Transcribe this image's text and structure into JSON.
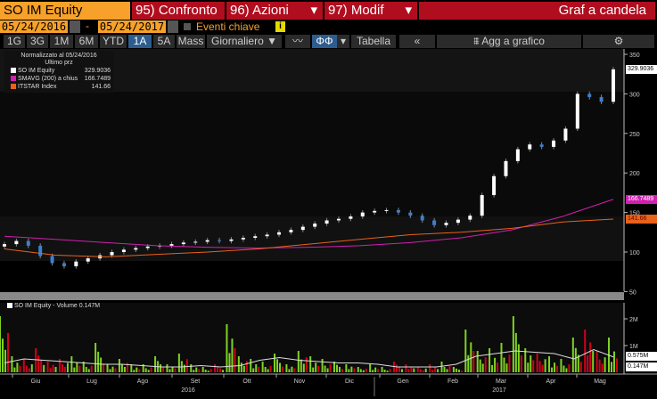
{
  "header": {
    "ticker": "SO IM Equity",
    "menu1": "95) Confronto",
    "menu2": "96) Azioni",
    "menu3": "97) Modif",
    "title": "Graf a candela"
  },
  "dates": {
    "start": "05/24/2016",
    "end": "05/24/2017",
    "separator": "-",
    "events_label": "Eventi chiave",
    "info_icon": "i"
  },
  "toolbar": {
    "periods": [
      "1G",
      "3G",
      "1M",
      "6M",
      "YTD",
      "1A",
      "5A",
      "Mass"
    ],
    "selected": "1A",
    "frequency": "Giornaliero ▼",
    "table": "Tabella",
    "back": "«",
    "add": "Agg a grafico"
  },
  "legend": {
    "title": "Normalizzato al 05/24/2016",
    "subtitle": "Ultimo prz",
    "items": [
      {
        "name": "SO IM Equity",
        "value": "329.9036",
        "color": "#ffffff"
      },
      {
        "name": "SMAVG (200) a chius",
        "value": "166.7489",
        "color": "#d020b0"
      },
      {
        "name": "ITSTAR Index",
        "value": "141.66",
        "color": "#e8621a"
      }
    ]
  },
  "volume_legend": {
    "name": "SO IM Equity - Volume",
    "value": "0.147M"
  },
  "price_labels": {
    "last": "329.9036",
    "sma": "166.7489",
    "index": "141.66"
  },
  "volume_labels": {
    "avg": "0.575M",
    "last": "0.147M"
  },
  "chart_data": {
    "type": "candlestick",
    "y_ticks": [
      "350",
      "300",
      "250",
      "200",
      "150",
      "100",
      "50"
    ],
    "y_tick_values": [
      350,
      300,
      250,
      200,
      150,
      100,
      50
    ],
    "ylim": [
      50,
      350
    ],
    "vol_ticks": [
      "2M",
      "1M"
    ],
    "vol_tick_values": [
      2,
      1
    ],
    "vol_ylim": [
      0,
      2.7
    ],
    "months": [
      "Giu",
      "Lug",
      "Ago",
      "Set",
      "Ott",
      "Nov",
      "Dic",
      "Gen",
      "Feb",
      "Mar",
      "Apr",
      "Mag"
    ],
    "years": [
      "2016",
      "2017"
    ],
    "closes": [
      110,
      114,
      108,
      95,
      86,
      82,
      88,
      92,
      96,
      100,
      103,
      105,
      107,
      108,
      110,
      112,
      113,
      115,
      114,
      116,
      118,
      120,
      122,
      125,
      128,
      132,
      136,
      140,
      142,
      145,
      150,
      152,
      153,
      150,
      146,
      140,
      134,
      137,
      141,
      146,
      172,
      196,
      215,
      230,
      236,
      233,
      241,
      256,
      300,
      296,
      290,
      331
    ],
    "sma": [
      120,
      116,
      112,
      108,
      106,
      105,
      106,
      108,
      112,
      118,
      128,
      145,
      166.75
    ],
    "index": [
      104,
      96,
      94,
      97,
      100,
      104,
      110,
      116,
      122,
      125,
      130,
      138,
      141.66
    ],
    "volume_m": [
      2.1,
      0.6,
      0.5,
      0.9,
      0.4,
      0.5,
      0.6,
      0.4,
      1.1,
      0.3,
      0.5,
      0.3,
      0.3,
      0.6,
      0.3,
      0.7,
      0.3,
      0.2,
      0.3,
      1.8,
      0.6,
      0.5,
      0.4,
      0.7,
      0.3,
      0.8,
      0.6,
      0.5,
      0.4,
      0.3,
      0.2,
      0.3,
      0.2,
      0.4,
      0.3,
      0.2,
      0.3,
      0.4,
      0.2,
      1.6,
      0.8,
      0.9,
      1.1,
      2.1,
      0.9,
      0.7,
      0.6,
      0.5,
      1.3,
      1.6,
      0.8,
      1.3
    ],
    "volume_avg_m": [
      0.35,
      0.5,
      0.45,
      0.4,
      0.35,
      0.3,
      0.3,
      0.25,
      0.2,
      0.2,
      0.25,
      0.2,
      0.25,
      0.45,
      0.55,
      0.45,
      0.4,
      0.35,
      0.35,
      0.3,
      0.2,
      0.2,
      0.2,
      0.3,
      0.6,
      0.7,
      0.8,
      0.75,
      0.7,
      0.5,
      0.85,
      0.575
    ]
  }
}
